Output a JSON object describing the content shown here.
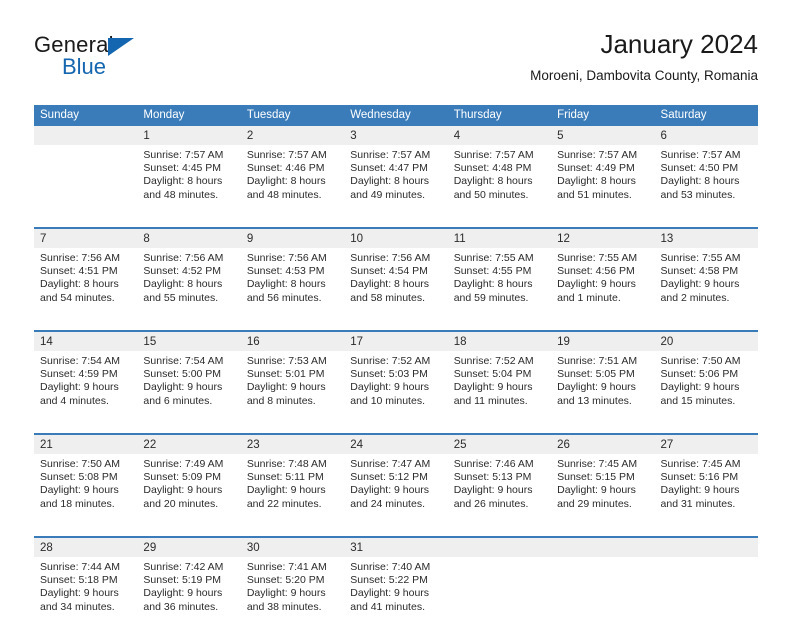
{
  "logo": {
    "word_one": "General",
    "word_two": "Blue",
    "icon": "triangle-icon"
  },
  "header": {
    "title": "January 2024",
    "subtitle": "Moroeni, Dambovita County, Romania"
  },
  "colors": {
    "header_blue": "#3a7cb9",
    "daynum_band": "#efefef",
    "logo_blue": "#1566b0",
    "text": "#2b2b2b"
  },
  "weekday_headers": [
    "Sunday",
    "Monday",
    "Tuesday",
    "Wednesday",
    "Thursday",
    "Friday",
    "Saturday"
  ],
  "weeks": [
    [
      {
        "day": "",
        "sunrise": "",
        "sunset": "",
        "daylight_line1": "",
        "daylight_line2": ""
      },
      {
        "day": "1",
        "sunrise": "Sunrise: 7:57 AM",
        "sunset": "Sunset: 4:45 PM",
        "daylight_line1": "Daylight: 8 hours",
        "daylight_line2": "and 48 minutes."
      },
      {
        "day": "2",
        "sunrise": "Sunrise: 7:57 AM",
        "sunset": "Sunset: 4:46 PM",
        "daylight_line1": "Daylight: 8 hours",
        "daylight_line2": "and 48 minutes."
      },
      {
        "day": "3",
        "sunrise": "Sunrise: 7:57 AM",
        "sunset": "Sunset: 4:47 PM",
        "daylight_line1": "Daylight: 8 hours",
        "daylight_line2": "and 49 minutes."
      },
      {
        "day": "4",
        "sunrise": "Sunrise: 7:57 AM",
        "sunset": "Sunset: 4:48 PM",
        "daylight_line1": "Daylight: 8 hours",
        "daylight_line2": "and 50 minutes."
      },
      {
        "day": "5",
        "sunrise": "Sunrise: 7:57 AM",
        "sunset": "Sunset: 4:49 PM",
        "daylight_line1": "Daylight: 8 hours",
        "daylight_line2": "and 51 minutes."
      },
      {
        "day": "6",
        "sunrise": "Sunrise: 7:57 AM",
        "sunset": "Sunset: 4:50 PM",
        "daylight_line1": "Daylight: 8 hours",
        "daylight_line2": "and 53 minutes."
      }
    ],
    [
      {
        "day": "7",
        "sunrise": "Sunrise: 7:56 AM",
        "sunset": "Sunset: 4:51 PM",
        "daylight_line1": "Daylight: 8 hours",
        "daylight_line2": "and 54 minutes."
      },
      {
        "day": "8",
        "sunrise": "Sunrise: 7:56 AM",
        "sunset": "Sunset: 4:52 PM",
        "daylight_line1": "Daylight: 8 hours",
        "daylight_line2": "and 55 minutes."
      },
      {
        "day": "9",
        "sunrise": "Sunrise: 7:56 AM",
        "sunset": "Sunset: 4:53 PM",
        "daylight_line1": "Daylight: 8 hours",
        "daylight_line2": "and 56 minutes."
      },
      {
        "day": "10",
        "sunrise": "Sunrise: 7:56 AM",
        "sunset": "Sunset: 4:54 PM",
        "daylight_line1": "Daylight: 8 hours",
        "daylight_line2": "and 58 minutes."
      },
      {
        "day": "11",
        "sunrise": "Sunrise: 7:55 AM",
        "sunset": "Sunset: 4:55 PM",
        "daylight_line1": "Daylight: 8 hours",
        "daylight_line2": "and 59 minutes."
      },
      {
        "day": "12",
        "sunrise": "Sunrise: 7:55 AM",
        "sunset": "Sunset: 4:56 PM",
        "daylight_line1": "Daylight: 9 hours",
        "daylight_line2": "and 1 minute."
      },
      {
        "day": "13",
        "sunrise": "Sunrise: 7:55 AM",
        "sunset": "Sunset: 4:58 PM",
        "daylight_line1": "Daylight: 9 hours",
        "daylight_line2": "and 2 minutes."
      }
    ],
    [
      {
        "day": "14",
        "sunrise": "Sunrise: 7:54 AM",
        "sunset": "Sunset: 4:59 PM",
        "daylight_line1": "Daylight: 9 hours",
        "daylight_line2": "and 4 minutes."
      },
      {
        "day": "15",
        "sunrise": "Sunrise: 7:54 AM",
        "sunset": "Sunset: 5:00 PM",
        "daylight_line1": "Daylight: 9 hours",
        "daylight_line2": "and 6 minutes."
      },
      {
        "day": "16",
        "sunrise": "Sunrise: 7:53 AM",
        "sunset": "Sunset: 5:01 PM",
        "daylight_line1": "Daylight: 9 hours",
        "daylight_line2": "and 8 minutes."
      },
      {
        "day": "17",
        "sunrise": "Sunrise: 7:52 AM",
        "sunset": "Sunset: 5:03 PM",
        "daylight_line1": "Daylight: 9 hours",
        "daylight_line2": "and 10 minutes."
      },
      {
        "day": "18",
        "sunrise": "Sunrise: 7:52 AM",
        "sunset": "Sunset: 5:04 PM",
        "daylight_line1": "Daylight: 9 hours",
        "daylight_line2": "and 11 minutes."
      },
      {
        "day": "19",
        "sunrise": "Sunrise: 7:51 AM",
        "sunset": "Sunset: 5:05 PM",
        "daylight_line1": "Daylight: 9 hours",
        "daylight_line2": "and 13 minutes."
      },
      {
        "day": "20",
        "sunrise": "Sunrise: 7:50 AM",
        "sunset": "Sunset: 5:06 PM",
        "daylight_line1": "Daylight: 9 hours",
        "daylight_line2": "and 15 minutes."
      }
    ],
    [
      {
        "day": "21",
        "sunrise": "Sunrise: 7:50 AM",
        "sunset": "Sunset: 5:08 PM",
        "daylight_line1": "Daylight: 9 hours",
        "daylight_line2": "and 18 minutes."
      },
      {
        "day": "22",
        "sunrise": "Sunrise: 7:49 AM",
        "sunset": "Sunset: 5:09 PM",
        "daylight_line1": "Daylight: 9 hours",
        "daylight_line2": "and 20 minutes."
      },
      {
        "day": "23",
        "sunrise": "Sunrise: 7:48 AM",
        "sunset": "Sunset: 5:11 PM",
        "daylight_line1": "Daylight: 9 hours",
        "daylight_line2": "and 22 minutes."
      },
      {
        "day": "24",
        "sunrise": "Sunrise: 7:47 AM",
        "sunset": "Sunset: 5:12 PM",
        "daylight_line1": "Daylight: 9 hours",
        "daylight_line2": "and 24 minutes."
      },
      {
        "day": "25",
        "sunrise": "Sunrise: 7:46 AM",
        "sunset": "Sunset: 5:13 PM",
        "daylight_line1": "Daylight: 9 hours",
        "daylight_line2": "and 26 minutes."
      },
      {
        "day": "26",
        "sunrise": "Sunrise: 7:45 AM",
        "sunset": "Sunset: 5:15 PM",
        "daylight_line1": "Daylight: 9 hours",
        "daylight_line2": "and 29 minutes."
      },
      {
        "day": "27",
        "sunrise": "Sunrise: 7:45 AM",
        "sunset": "Sunset: 5:16 PM",
        "daylight_line1": "Daylight: 9 hours",
        "daylight_line2": "and 31 minutes."
      }
    ],
    [
      {
        "day": "28",
        "sunrise": "Sunrise: 7:44 AM",
        "sunset": "Sunset: 5:18 PM",
        "daylight_line1": "Daylight: 9 hours",
        "daylight_line2": "and 34 minutes."
      },
      {
        "day": "29",
        "sunrise": "Sunrise: 7:42 AM",
        "sunset": "Sunset: 5:19 PM",
        "daylight_line1": "Daylight: 9 hours",
        "daylight_line2": "and 36 minutes."
      },
      {
        "day": "30",
        "sunrise": "Sunrise: 7:41 AM",
        "sunset": "Sunset: 5:20 PM",
        "daylight_line1": "Daylight: 9 hours",
        "daylight_line2": "and 38 minutes."
      },
      {
        "day": "31",
        "sunrise": "Sunrise: 7:40 AM",
        "sunset": "Sunset: 5:22 PM",
        "daylight_line1": "Daylight: 9 hours",
        "daylight_line2": "and 41 minutes."
      },
      {
        "day": "",
        "sunrise": "",
        "sunset": "",
        "daylight_line1": "",
        "daylight_line2": ""
      },
      {
        "day": "",
        "sunrise": "",
        "sunset": "",
        "daylight_line1": "",
        "daylight_line2": ""
      },
      {
        "day": "",
        "sunrise": "",
        "sunset": "",
        "daylight_line1": "",
        "daylight_line2": ""
      }
    ]
  ]
}
